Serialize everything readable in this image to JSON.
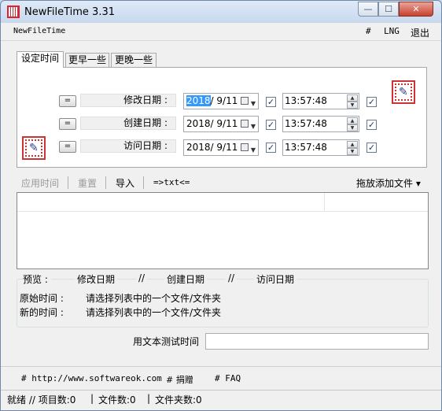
{
  "window": {
    "title": "NewFileTime 3.31",
    "min": "—",
    "max": "☐",
    "close": "✕"
  },
  "menubar": {
    "app_name": "NewFileTime",
    "hash": "#",
    "lng": "LNG",
    "exit": "退出"
  },
  "tabs": [
    "设定时间",
    "更早一些",
    "更晚一些"
  ],
  "rows": [
    {
      "eq": "=",
      "label": "修改日期 :",
      "date_sel": "2018",
      "date_rest": "/ 9/11",
      "time": "13:57:48"
    },
    {
      "eq": "=",
      "label": "创建日期 :",
      "date_sel": "",
      "date_rest": "2018/ 9/11",
      "time": "13:57:48"
    },
    {
      "eq": "=",
      "label": "访问日期 :",
      "date_sel": "",
      "date_rest": "2018/ 9/11",
      "time": "13:57:48"
    }
  ],
  "check_mark": "✓",
  "toolbar": {
    "apply": "应用时间",
    "reset": "重置",
    "import": "导入",
    "txt": "=>txt<=",
    "drag_add": "拖放添加文件 ▾"
  },
  "preview": {
    "label": "预览  :",
    "mod": "修改日期",
    "sep1": "//",
    "create": "创建日期",
    "sep2": "//",
    "access": "访问日期"
  },
  "original": {
    "label": "原始时间 :",
    "value": "请选择列表中的一个文件/文件夹"
  },
  "new": {
    "label": "新的时间 :",
    "value": "请选择列表中的一个文件/文件夹"
  },
  "text_test": {
    "label": "用文本测试时间"
  },
  "links": {
    "site": "# http://www.softwareok.com",
    "donate": "# 捐赠",
    "faq": "# FAQ"
  },
  "status": {
    "ready": "就绪 // 项目数:0",
    "files": "文件数:0",
    "folders": "文件夹数:0"
  }
}
